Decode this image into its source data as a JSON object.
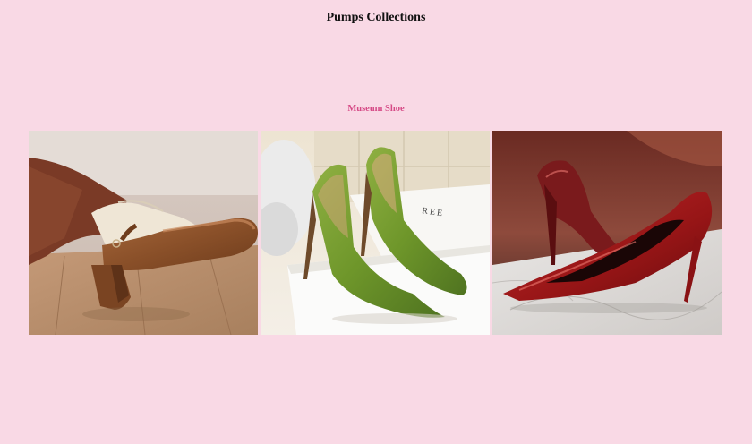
{
  "header": {
    "title": "Pumps Collections"
  },
  "section": {
    "label": "Museum Shoe"
  },
  "gallery": {
    "images": [
      {
        "name": "brown-mary-jane-pump-image",
        "alt": "Brown patent mary jane pumps with white socks"
      },
      {
        "name": "green-satin-pump-image",
        "alt": "Green satin pointed stiletto pumps"
      },
      {
        "name": "red-patent-pump-image",
        "alt": "Red patent pointed stiletto pumps"
      }
    ]
  },
  "colors": {
    "background": "#f9d9e5",
    "accent": "#d64a86",
    "title": "#111111"
  }
}
